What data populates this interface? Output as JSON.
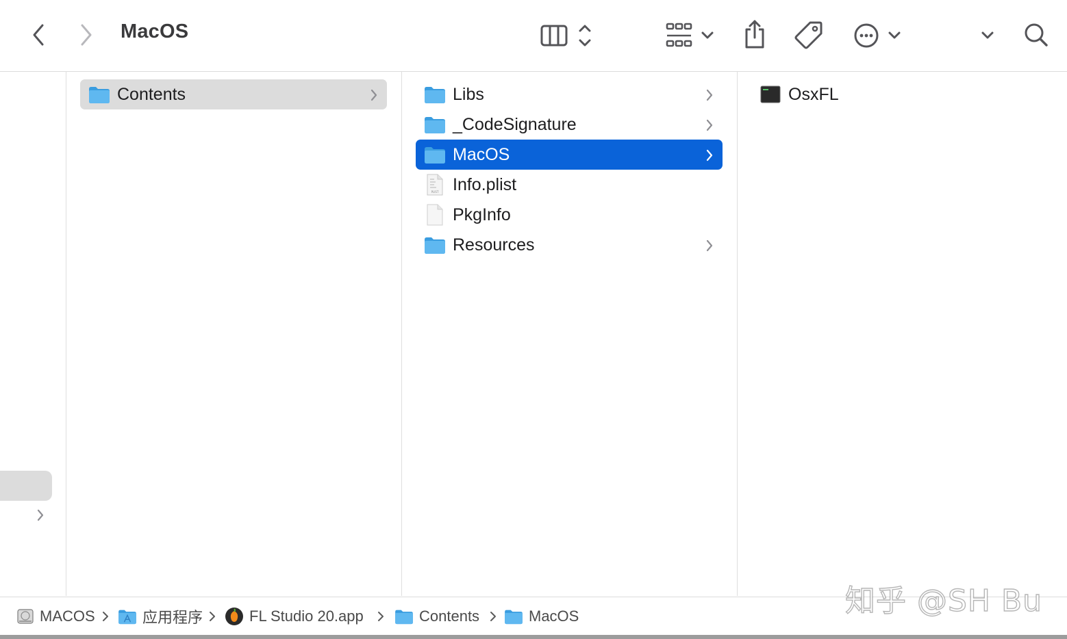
{
  "window": {
    "title": "MacOS"
  },
  "toolbar": {
    "back_icon": "chevron-left-icon",
    "forward_icon": "chevron-right-icon",
    "view_icon": "column-view-icon",
    "group_icon": "grid-group-icon",
    "share_icon": "share-icon",
    "tag_icon": "tag-icon",
    "more_icon": "ellipsis-circle-icon",
    "overflow_icon": "chevron-down-icon",
    "search_icon": "search-icon"
  },
  "columns": {
    "col1": [
      {
        "label": "Contents",
        "type": "folder",
        "has_children": true,
        "state": "selected-inactive"
      }
    ],
    "col2": [
      {
        "label": "Libs",
        "type": "folder",
        "has_children": true,
        "state": ""
      },
      {
        "label": "_CodeSignature",
        "type": "folder",
        "has_children": true,
        "state": ""
      },
      {
        "label": "MacOS",
        "type": "folder",
        "has_children": true,
        "state": "selected-active"
      },
      {
        "label": "Info.plist",
        "type": "plist",
        "has_children": false,
        "state": ""
      },
      {
        "label": "PkgInfo",
        "type": "file",
        "has_children": false,
        "state": ""
      },
      {
        "label": "Resources",
        "type": "folder",
        "has_children": true,
        "state": ""
      }
    ],
    "col3": [
      {
        "label": "OsxFL",
        "type": "exec",
        "has_children": false,
        "state": ""
      }
    ]
  },
  "pathbar": [
    {
      "label": "MACOS",
      "icon": "disk-icon"
    },
    {
      "label": "应用程序",
      "icon": "applications-folder-icon"
    },
    {
      "label": "FL Studio 20.app",
      "icon": "fl-studio-app-icon"
    },
    {
      "label": "Contents",
      "icon": "folder-icon"
    },
    {
      "label": "MacOS",
      "icon": "folder-icon"
    }
  ],
  "watermark": "知乎 @SH Bu",
  "colors": {
    "accent": "#0a63d9",
    "folder": "#5fb8f0",
    "inactive_selection": "#dcdcdc"
  }
}
